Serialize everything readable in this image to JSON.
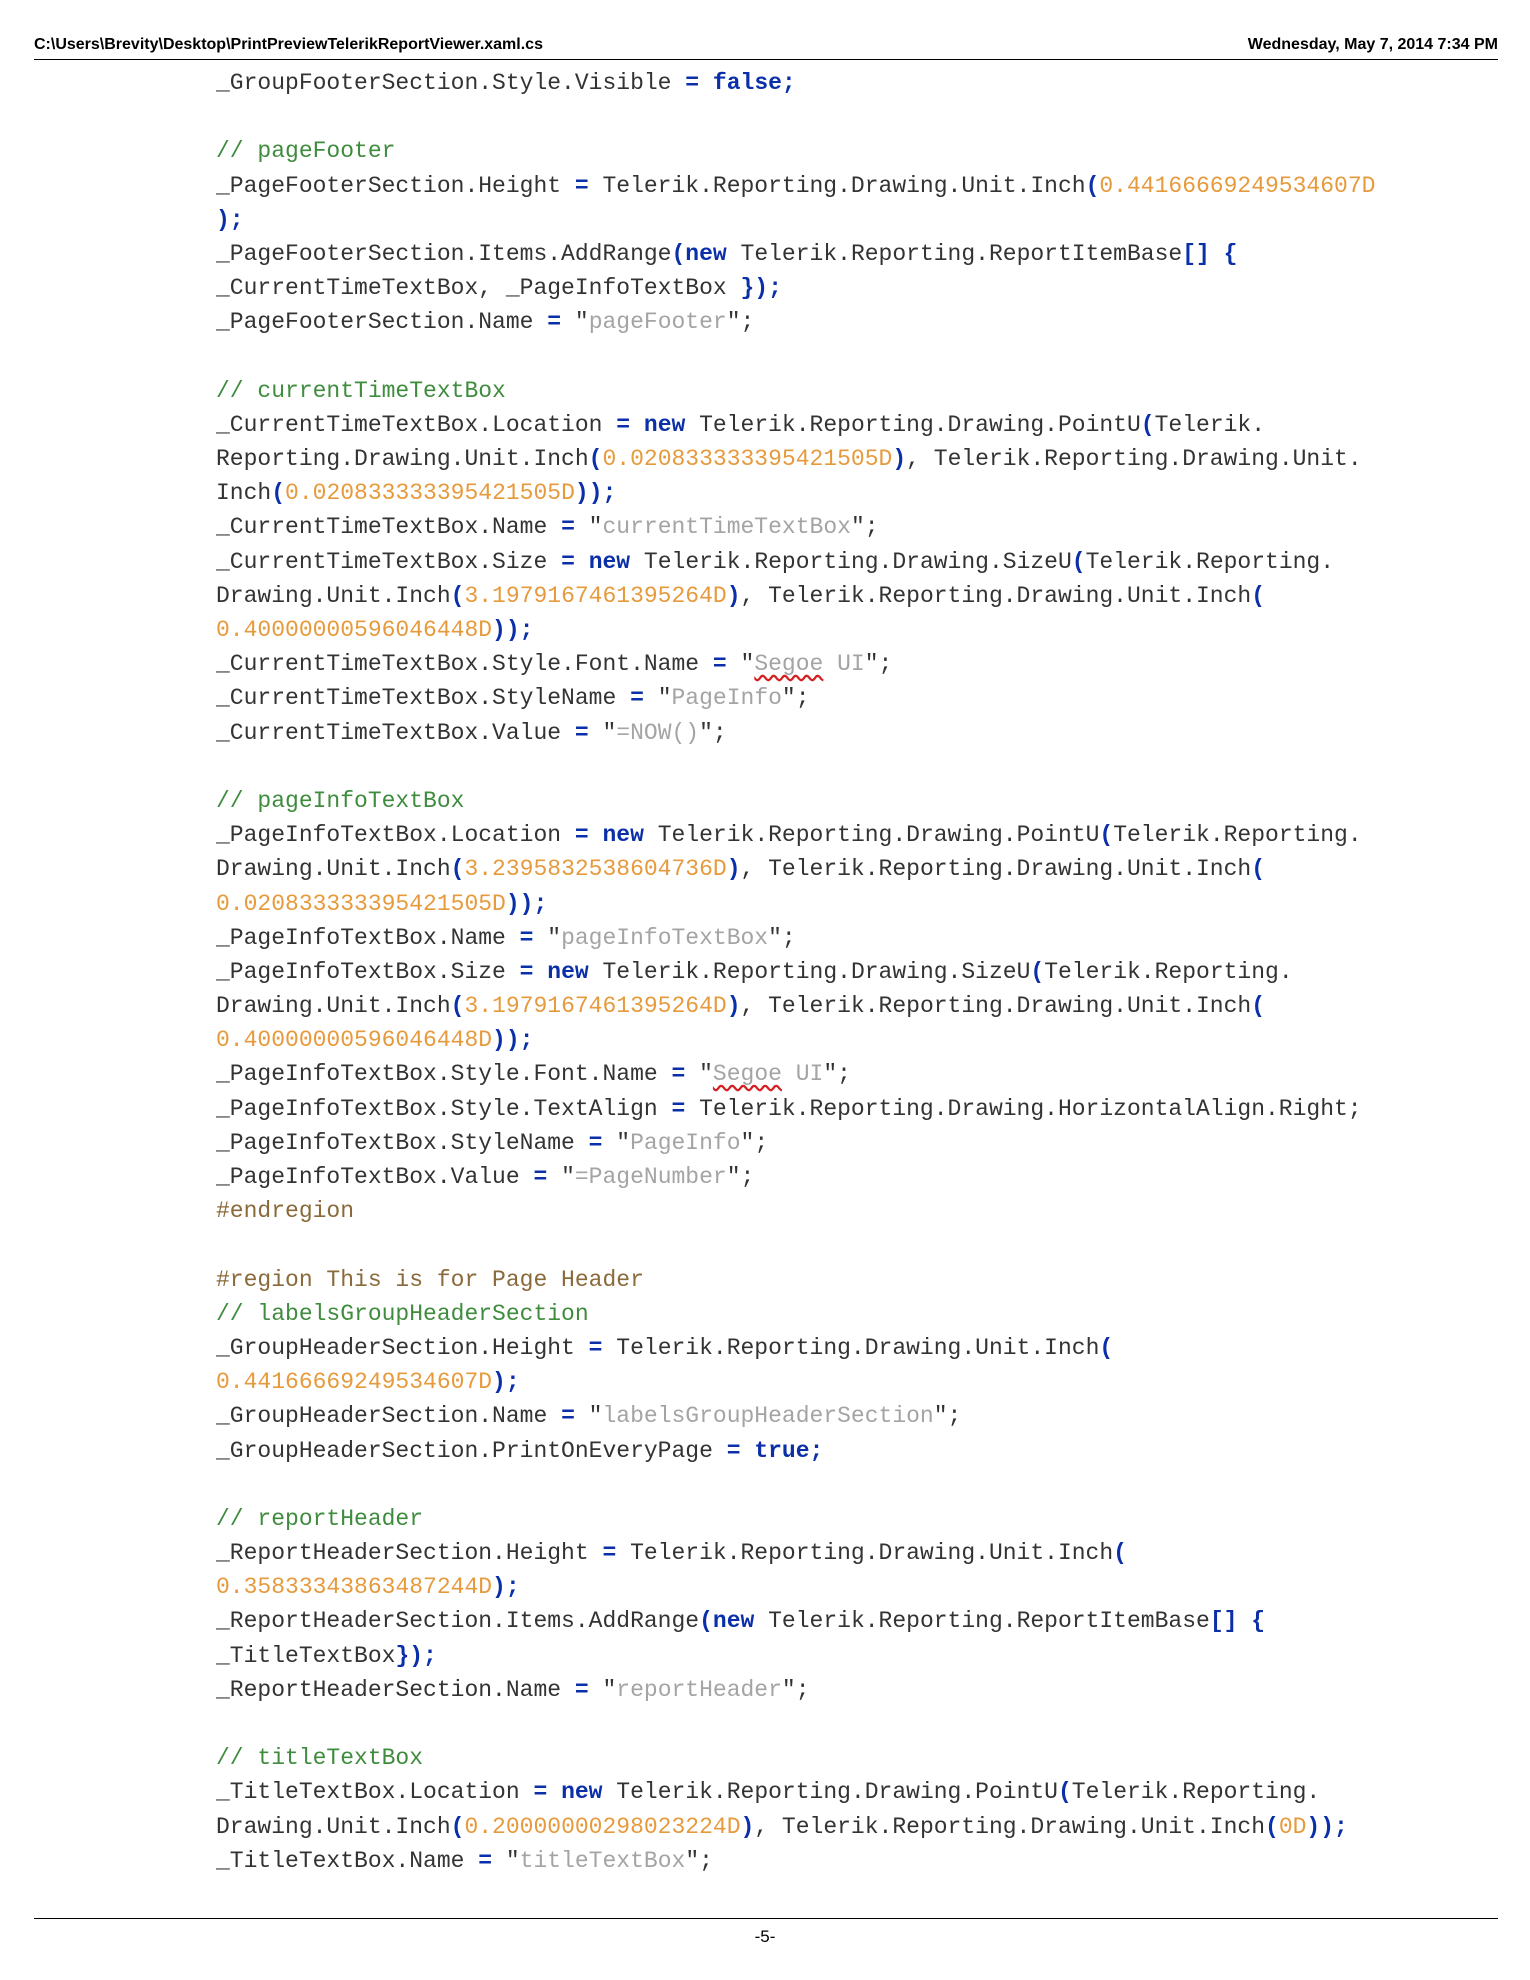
{
  "header": {
    "file_path": "C:\\Users\\Brevity\\Desktop\\PrintPreviewTelerikReportViewer.xaml.cs",
    "date": "Wednesday, May 7, 2014 7:34 PM"
  },
  "footer": {
    "page_number": "-5-"
  },
  "code_lines": [
    [
      [
        "id",
        "_GroupFooterSection.Style.Visible "
      ],
      [
        "pn",
        "="
      ],
      [
        "id",
        " "
      ],
      [
        "kw",
        "false"
      ],
      [
        "pn",
        ";"
      ]
    ],
    [],
    [
      [
        "cm",
        "// pageFooter"
      ]
    ],
    [
      [
        "id",
        "_PageFooterSection.Height "
      ],
      [
        "pn",
        "="
      ],
      [
        "id",
        " Telerik.Reporting.Drawing.Unit.Inch"
      ],
      [
        "pn",
        "("
      ],
      [
        "nm",
        "0.44166669249534607D"
      ]
    ],
    [
      [
        "pn",
        ");"
      ]
    ],
    [
      [
        "id",
        "_PageFooterSection.Items.AddRange"
      ],
      [
        "pn",
        "("
      ],
      [
        "kw",
        "new"
      ],
      [
        "id",
        " Telerik.Reporting.ReportItemBase"
      ],
      [
        "pn",
        "[] {"
      ]
    ],
    [
      [
        "id",
        "_CurrentTimeTextBox, _PageInfoTextBox "
      ],
      [
        "pn",
        "});"
      ]
    ],
    [
      [
        "id",
        "_PageFooterSection.Name "
      ],
      [
        "pn",
        "="
      ],
      [
        "id",
        " \""
      ],
      [
        "st",
        "pageFooter"
      ],
      [
        "id",
        "\";"
      ]
    ],
    [],
    [
      [
        "cm",
        "// currentTimeTextBox"
      ]
    ],
    [
      [
        "id",
        "_CurrentTimeTextBox.Location "
      ],
      [
        "pn",
        "="
      ],
      [
        "id",
        " "
      ],
      [
        "kw",
        "new"
      ],
      [
        "id",
        " Telerik.Reporting.Drawing.PointU"
      ],
      [
        "pn",
        "("
      ],
      [
        "id",
        "Telerik."
      ]
    ],
    [
      [
        "id",
        "Reporting.Drawing.Unit.Inch"
      ],
      [
        "pn",
        "("
      ],
      [
        "nm",
        "0.020833333395421505D"
      ],
      [
        "pn",
        ")"
      ],
      [
        "id",
        ", Telerik.Reporting.Drawing.Unit."
      ]
    ],
    [
      [
        "id",
        "Inch"
      ],
      [
        "pn",
        "("
      ],
      [
        "nm",
        "0.020833333395421505D"
      ],
      [
        "pn",
        "));"
      ]
    ],
    [
      [
        "id",
        "_CurrentTimeTextBox.Name "
      ],
      [
        "pn",
        "="
      ],
      [
        "id",
        " \""
      ],
      [
        "st",
        "currentTimeTextBox"
      ],
      [
        "id",
        "\";"
      ]
    ],
    [
      [
        "id",
        "_CurrentTimeTextBox.Size "
      ],
      [
        "pn",
        "="
      ],
      [
        "id",
        " "
      ],
      [
        "kw",
        "new"
      ],
      [
        "id",
        " Telerik.Reporting.Drawing.SizeU"
      ],
      [
        "pn",
        "("
      ],
      [
        "id",
        "Telerik.Reporting."
      ]
    ],
    [
      [
        "id",
        "Drawing.Unit.Inch"
      ],
      [
        "pn",
        "("
      ],
      [
        "nm",
        "3.1979167461395264D"
      ],
      [
        "pn",
        ")"
      ],
      [
        "id",
        ", Telerik.Reporting.Drawing.Unit.Inch"
      ],
      [
        "pn",
        "("
      ]
    ],
    [
      [
        "nm",
        "0.40000000596046448D"
      ],
      [
        "pn",
        "));"
      ]
    ],
    [
      [
        "id",
        "_CurrentTimeTextBox.Style.Font.Name "
      ],
      [
        "pn",
        "="
      ],
      [
        "id",
        " \""
      ],
      [
        "sq",
        "Segoe"
      ],
      [
        "st",
        " UI"
      ],
      [
        "id",
        "\";"
      ]
    ],
    [
      [
        "id",
        "_CurrentTimeTextBox.StyleName "
      ],
      [
        "pn",
        "="
      ],
      [
        "id",
        " \""
      ],
      [
        "st",
        "PageInfo"
      ],
      [
        "id",
        "\";"
      ]
    ],
    [
      [
        "id",
        "_CurrentTimeTextBox.Value "
      ],
      [
        "pn",
        "="
      ],
      [
        "id",
        " \""
      ],
      [
        "st",
        "=NOW()"
      ],
      [
        "id",
        "\";"
      ]
    ],
    [],
    [
      [
        "cm",
        "// pageInfoTextBox"
      ]
    ],
    [
      [
        "id",
        "_PageInfoTextBox.Location "
      ],
      [
        "pn",
        "="
      ],
      [
        "id",
        " "
      ],
      [
        "kw",
        "new"
      ],
      [
        "id",
        " Telerik.Reporting.Drawing.PointU"
      ],
      [
        "pn",
        "("
      ],
      [
        "id",
        "Telerik.Reporting."
      ]
    ],
    [
      [
        "id",
        "Drawing.Unit.Inch"
      ],
      [
        "pn",
        "("
      ],
      [
        "nm",
        "3.2395832538604736D"
      ],
      [
        "pn",
        ")"
      ],
      [
        "id",
        ", Telerik.Reporting.Drawing.Unit.Inch"
      ],
      [
        "pn",
        "("
      ]
    ],
    [
      [
        "nm",
        "0.020833333395421505D"
      ],
      [
        "pn",
        "));"
      ]
    ],
    [
      [
        "id",
        "_PageInfoTextBox.Name "
      ],
      [
        "pn",
        "="
      ],
      [
        "id",
        " \""
      ],
      [
        "st",
        "pageInfoTextBox"
      ],
      [
        "id",
        "\";"
      ]
    ],
    [
      [
        "id",
        "_PageInfoTextBox.Size "
      ],
      [
        "pn",
        "="
      ],
      [
        "id",
        " "
      ],
      [
        "kw",
        "new"
      ],
      [
        "id",
        " Telerik.Reporting.Drawing.SizeU"
      ],
      [
        "pn",
        "("
      ],
      [
        "id",
        "Telerik.Reporting."
      ]
    ],
    [
      [
        "id",
        "Drawing.Unit.Inch"
      ],
      [
        "pn",
        "("
      ],
      [
        "nm",
        "3.1979167461395264D"
      ],
      [
        "pn",
        ")"
      ],
      [
        "id",
        ", Telerik.Reporting.Drawing.Unit.Inch"
      ],
      [
        "pn",
        "("
      ]
    ],
    [
      [
        "nm",
        "0.40000000596046448D"
      ],
      [
        "pn",
        "));"
      ]
    ],
    [
      [
        "id",
        "_PageInfoTextBox.Style.Font.Name "
      ],
      [
        "pn",
        "="
      ],
      [
        "id",
        " \""
      ],
      [
        "sq",
        "Segoe"
      ],
      [
        "st",
        " UI"
      ],
      [
        "id",
        "\";"
      ]
    ],
    [
      [
        "id",
        "_PageInfoTextBox.Style.TextAlign "
      ],
      [
        "pn",
        "="
      ],
      [
        "id",
        " Telerik.Reporting.Drawing.HorizontalAlign.Right;"
      ]
    ],
    [
      [
        "id",
        "_PageInfoTextBox.StyleName "
      ],
      [
        "pn",
        "="
      ],
      [
        "id",
        " \""
      ],
      [
        "st",
        "PageInfo"
      ],
      [
        "id",
        "\";"
      ]
    ],
    [
      [
        "id",
        "_PageInfoTextBox.Value "
      ],
      [
        "pn",
        "="
      ],
      [
        "id",
        " \""
      ],
      [
        "st",
        "=PageNumber"
      ],
      [
        "id",
        "\";"
      ]
    ],
    [
      [
        "pp",
        "#endregion"
      ]
    ],
    [],
    [
      [
        "pp",
        "#region This is for Page Header"
      ]
    ],
    [
      [
        "cm",
        "// labelsGroupHeaderSection"
      ]
    ],
    [
      [
        "id",
        "_GroupHeaderSection.Height "
      ],
      [
        "pn",
        "="
      ],
      [
        "id",
        " Telerik.Reporting.Drawing.Unit.Inch"
      ],
      [
        "pn",
        "("
      ]
    ],
    [
      [
        "nm",
        "0.44166669249534607D"
      ],
      [
        "pn",
        ");"
      ]
    ],
    [
      [
        "id",
        "_GroupHeaderSection.Name "
      ],
      [
        "pn",
        "="
      ],
      [
        "id",
        " \""
      ],
      [
        "st",
        "labelsGroupHeaderSection"
      ],
      [
        "id",
        "\";"
      ]
    ],
    [
      [
        "id",
        "_GroupHeaderSection.PrintOnEveryPage "
      ],
      [
        "pn",
        "="
      ],
      [
        "id",
        " "
      ],
      [
        "kw",
        "true"
      ],
      [
        "pn",
        ";"
      ]
    ],
    [],
    [
      [
        "cm",
        "// reportHeader"
      ]
    ],
    [
      [
        "id",
        "_ReportHeaderSection.Height "
      ],
      [
        "pn",
        "="
      ],
      [
        "id",
        " Telerik.Reporting.Drawing.Unit.Inch"
      ],
      [
        "pn",
        "("
      ]
    ],
    [
      [
        "nm",
        "0.35833343863487244D"
      ],
      [
        "pn",
        ");"
      ]
    ],
    [
      [
        "id",
        "_ReportHeaderSection.Items.AddRange"
      ],
      [
        "pn",
        "("
      ],
      [
        "kw",
        "new"
      ],
      [
        "id",
        " Telerik.Reporting.ReportItemBase"
      ],
      [
        "pn",
        "[] {"
      ]
    ],
    [
      [
        "id",
        "_TitleTextBox"
      ],
      [
        "pn",
        "});"
      ]
    ],
    [
      [
        "id",
        "_ReportHeaderSection.Name "
      ],
      [
        "pn",
        "="
      ],
      [
        "id",
        " \""
      ],
      [
        "st",
        "reportHeader"
      ],
      [
        "id",
        "\";"
      ]
    ],
    [],
    [
      [
        "cm",
        "// titleTextBox"
      ]
    ],
    [
      [
        "id",
        "_TitleTextBox.Location "
      ],
      [
        "pn",
        "="
      ],
      [
        "id",
        " "
      ],
      [
        "kw",
        "new"
      ],
      [
        "id",
        " Telerik.Reporting.Drawing.PointU"
      ],
      [
        "pn",
        "("
      ],
      [
        "id",
        "Telerik.Reporting."
      ]
    ],
    [
      [
        "id",
        "Drawing.Unit.Inch"
      ],
      [
        "pn",
        "("
      ],
      [
        "nm",
        "0.20000000298023224D"
      ],
      [
        "pn",
        ")"
      ],
      [
        "id",
        ", Telerik.Reporting.Drawing.Unit.Inch"
      ],
      [
        "pn",
        "("
      ],
      [
        "nm",
        "0D"
      ],
      [
        "pn",
        "));"
      ]
    ],
    [
      [
        "id",
        "_TitleTextBox.Name "
      ],
      [
        "pn",
        "="
      ],
      [
        "id",
        " \""
      ],
      [
        "st",
        "titleTextBox"
      ],
      [
        "id",
        "\";"
      ]
    ]
  ]
}
